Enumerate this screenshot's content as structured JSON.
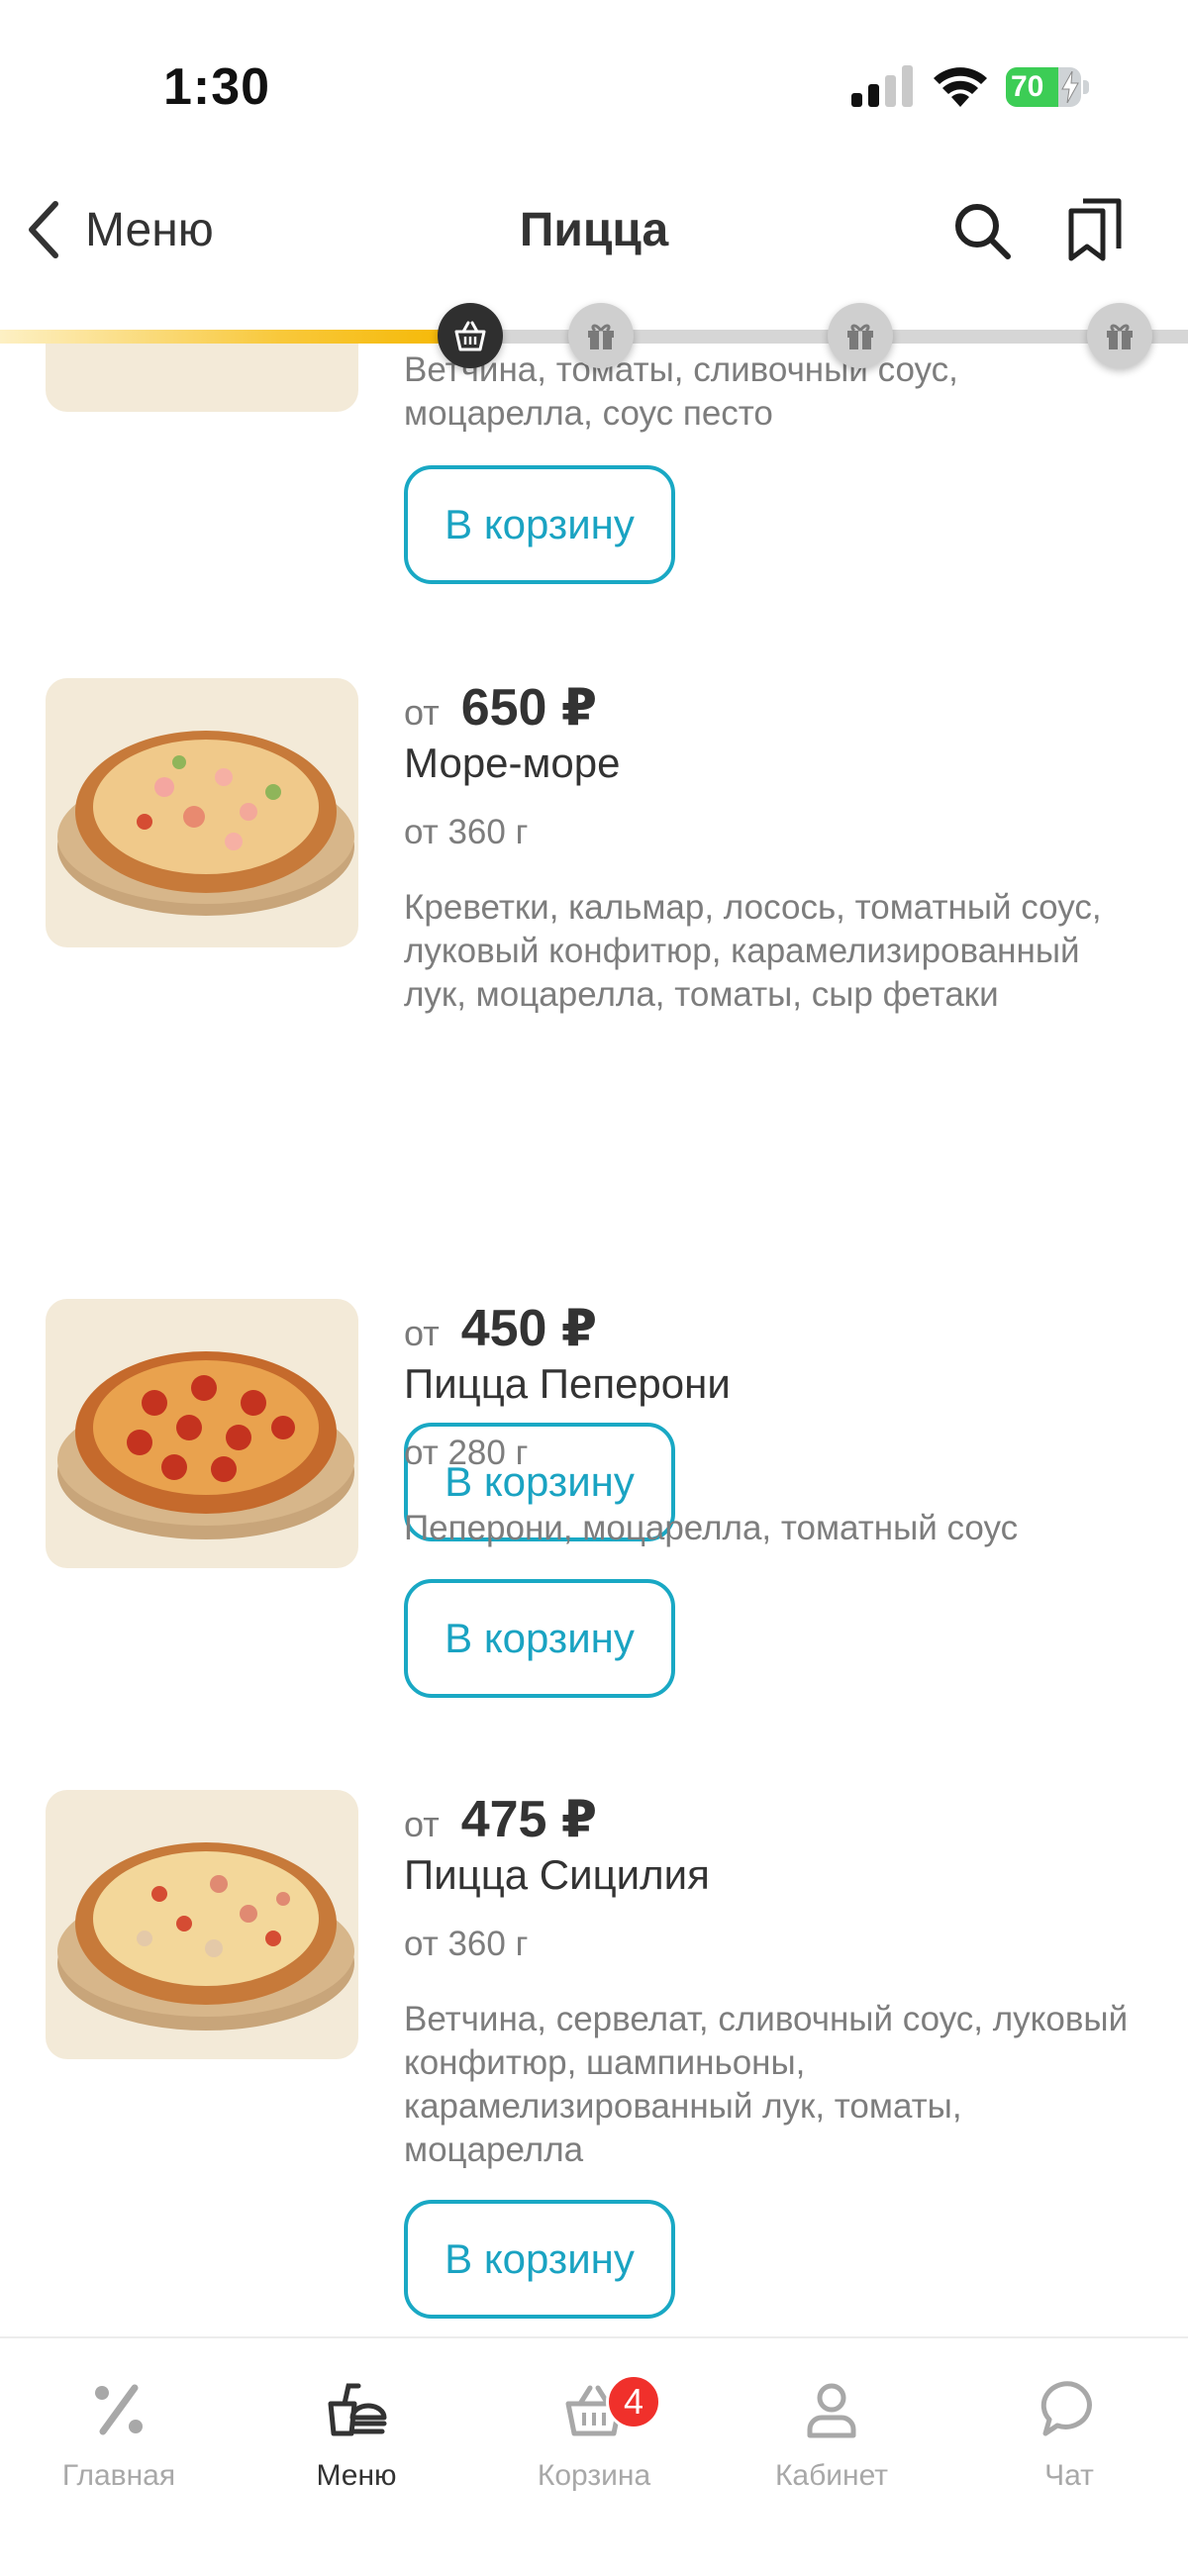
{
  "status_bar": {
    "time": "1:30",
    "battery_level": "70",
    "battery_color": "#3ccd55"
  },
  "header": {
    "back_label": "Меню",
    "title": "Пицца",
    "search_icon": "search-icon",
    "bookmark_icon": "bookmark-icon"
  },
  "progress": {
    "filled_fraction": 0.395,
    "milestones": [
      {
        "icon": "basket-icon",
        "active": true
      },
      {
        "icon": "gift-icon",
        "active": false
      },
      {
        "icon": "gift-icon",
        "active": false
      },
      {
        "icon": "gift-icon",
        "active": false
      }
    ]
  },
  "previous_item": {
    "description": "Ветчина, томаты, сливочный соус, моцарелла, соус песто",
    "cart_label": "В корзину"
  },
  "items": [
    {
      "price_prefix": "от",
      "price": "650 ₽",
      "name": "Море-море",
      "weight": "от 360 г",
      "description": "Креветки, кальмар, лосось, томатный соус, луковый конфитюр, карамелизированный лук, моцарелла, томаты, сыр фетаки",
      "cart_label": "В корзину"
    },
    {
      "price_prefix": "от",
      "price": "450 ₽",
      "name": "Пицца Пеперони",
      "weight": "от 280 г",
      "description": "Пеперони, моцарелла, томатный соус",
      "cart_label": "В корзину"
    },
    {
      "price_prefix": "от",
      "price": "475 ₽",
      "name": "Пицца Сицилия",
      "weight": "от 360 г",
      "description": "Ветчина, сервелат, сливочный соус, луковый конфитюр, шампиньоны, карамелизированный лук, томаты, моцарелла",
      "cart_label": "В корзину"
    }
  ],
  "tab_bar": {
    "tabs": [
      {
        "label": "Главная",
        "icon": "percent-icon",
        "active": false
      },
      {
        "label": "Меню",
        "icon": "menu-food-icon",
        "active": true
      },
      {
        "label": "Корзина",
        "icon": "cart-icon",
        "active": false,
        "badge": "4"
      },
      {
        "label": "Кабинет",
        "icon": "profile-icon",
        "active": false
      },
      {
        "label": "Чат",
        "icon": "chat-icon",
        "active": false
      }
    ],
    "badge_color": "#f0302b"
  },
  "accent_color": "#19a8c4"
}
